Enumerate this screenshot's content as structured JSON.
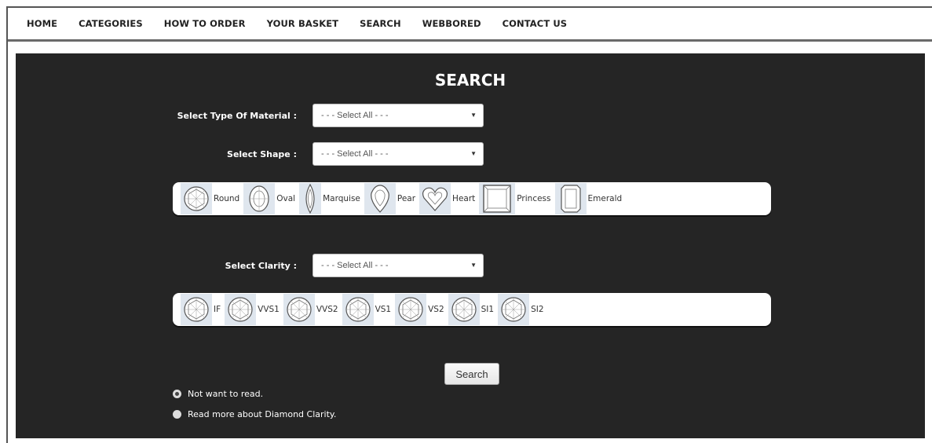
{
  "nav": {
    "items": [
      "HOME",
      "CATEGORIES",
      "HOW TO ORDER",
      "YOUR BASKET",
      "SEARCH",
      "WEBBORED",
      "CONTACT US"
    ]
  },
  "search": {
    "title": "SEARCH",
    "material_label": "Select Type Of Material :",
    "material_value": "- - - Select All - - -",
    "shape_label": "Select Shape :",
    "shape_value": "- - - Select All - - -",
    "shapes": [
      "Round",
      "Oval",
      "Marquise",
      "Pear",
      "Heart",
      "Princess",
      "Emerald"
    ],
    "clarity_label": "Select Clarity :",
    "clarity_value": "- - - Select All - - -",
    "clarities": [
      "IF",
      "VVS1",
      "VVS2",
      "VS1",
      "VS2",
      "SI1",
      "SI2"
    ],
    "button_label": "Search",
    "radio_not_read": "Not want to read.",
    "radio_read_more": "Read more about Diamond Clarity."
  },
  "colors": {
    "panel_bg": "#252525",
    "icon_bg": "#dfe6ee"
  }
}
